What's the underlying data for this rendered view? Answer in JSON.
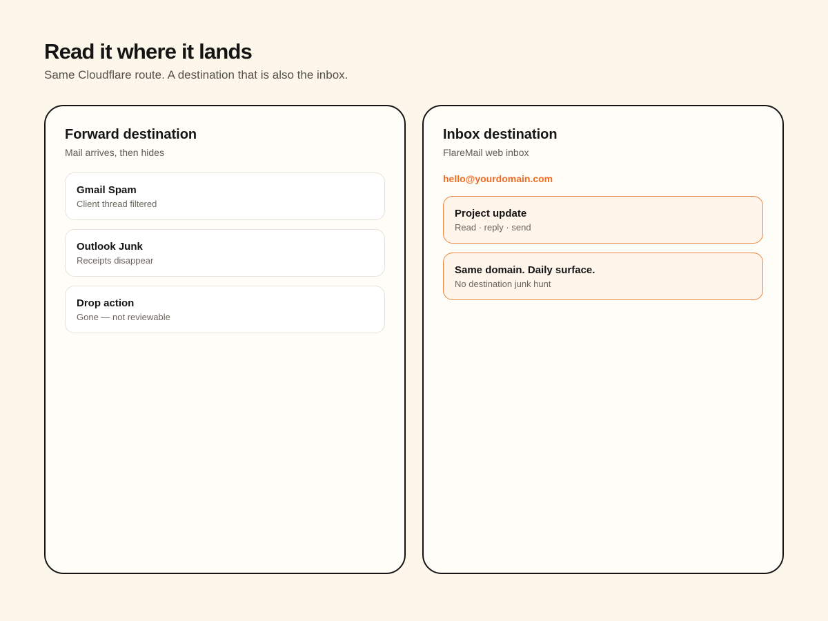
{
  "header": {
    "title": "Read it where it lands",
    "subtitle": "Same Cloudflare route. A destination that is also the inbox."
  },
  "forward": {
    "title": "Forward destination",
    "subtitle": "Mail arrives, then hides",
    "items": [
      {
        "title": "Gmail Spam",
        "sub": "Client thread filtered"
      },
      {
        "title": "Outlook Junk",
        "sub": "Receipts disappear"
      },
      {
        "title": "Drop action",
        "sub": "Gone — not reviewable"
      }
    ]
  },
  "inbox": {
    "title": "Inbox destination",
    "subtitle": "FlareMail web inbox",
    "address": "hello@yourdomain.com",
    "items": [
      {
        "title": "Project update",
        "sub": "Read · reply · send"
      },
      {
        "title": "Same domain. Daily surface.",
        "sub": "No destination junk hunt"
      }
    ]
  },
  "colors": {
    "background": "#fdf6ea",
    "accent": "#ef6c23",
    "panel_border": "#141414",
    "accent_card_bg": "#fff5eb"
  }
}
